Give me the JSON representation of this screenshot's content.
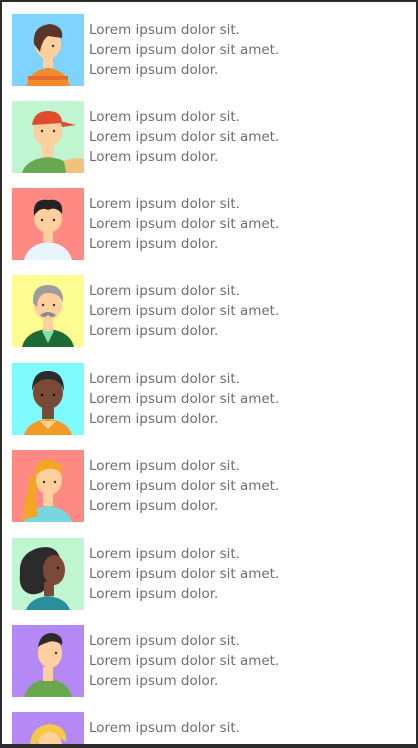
{
  "items": [
    {
      "lines": [
        "Lorem ipsum dolor sit.",
        "Lorem ipsum dolor sit amet.",
        "Lorem ipsum dolor."
      ],
      "bg": "#7fd3ff"
    },
    {
      "lines": [
        "Lorem ipsum dolor sit.",
        "Lorem ipsum dolor sit amet.",
        "Lorem ipsum dolor."
      ],
      "bg": "#bff5d0"
    },
    {
      "lines": [
        "Lorem ipsum dolor sit.",
        "Lorem ipsum dolor sit amet.",
        "Lorem ipsum dolor."
      ],
      "bg": "#ff8a84"
    },
    {
      "lines": [
        "Lorem ipsum dolor sit.",
        "Lorem ipsum dolor sit amet.",
        "Lorem ipsum dolor."
      ],
      "bg": "#fdfc91"
    },
    {
      "lines": [
        "Lorem ipsum dolor sit.",
        "Lorem ipsum dolor sit amet.",
        "Lorem ipsum dolor."
      ],
      "bg": "#7ffbff"
    },
    {
      "lines": [
        "Lorem ipsum dolor sit.",
        "Lorem ipsum dolor sit amet.",
        "Lorem ipsum dolor."
      ],
      "bg": "#ff8a84"
    },
    {
      "lines": [
        "Lorem ipsum dolor sit.",
        "Lorem ipsum dolor sit amet.",
        "Lorem ipsum dolor."
      ],
      "bg": "#bff5d0"
    },
    {
      "lines": [
        "Lorem ipsum dolor sit.",
        "Lorem ipsum dolor sit amet.",
        "Lorem ipsum dolor."
      ],
      "bg": "#b488f5"
    },
    {
      "lines": [
        "Lorem ipsum dolor sit."
      ],
      "bg": "#b488f5"
    }
  ]
}
